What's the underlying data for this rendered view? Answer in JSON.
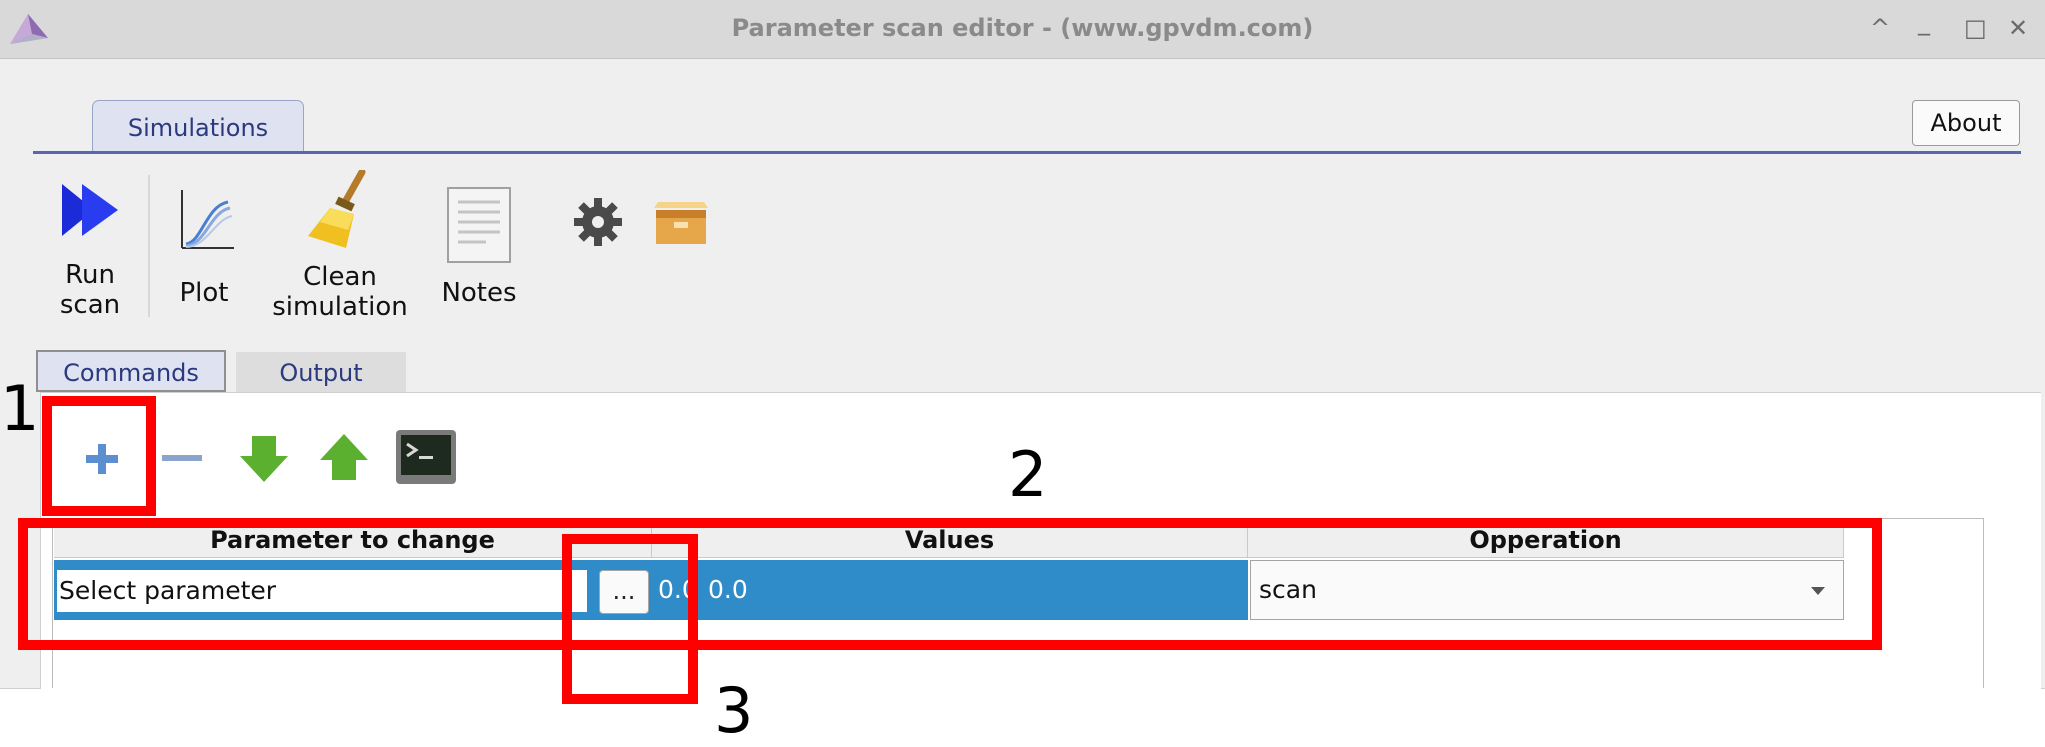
{
  "window": {
    "title": "Parameter scan editor - (www.gpvdm.com)",
    "controls": [
      "^",
      "_",
      "□",
      "✕"
    ]
  },
  "tabs": {
    "main": "Simulations",
    "about": "About"
  },
  "toolbar": {
    "run_line1": "Run",
    "run_line2": "scan",
    "plot": "Plot",
    "clean_line1": "Clean",
    "clean_line2": "simulation",
    "notes": "Notes"
  },
  "subtabs": {
    "commands": "Commands",
    "output": "Output"
  },
  "table": {
    "headers": [
      "Parameter to change",
      "Values",
      "Opperation"
    ],
    "row": {
      "parameter": "Select parameter",
      "browse": "...",
      "value_a": "0.0",
      "value_b": "0.0",
      "operation": "scan"
    }
  },
  "annotations": [
    "1",
    "2",
    "3"
  ],
  "colors": {
    "accent": "#5a66b2",
    "selection": "#2f8cc8",
    "annotation": "#ff0000"
  }
}
